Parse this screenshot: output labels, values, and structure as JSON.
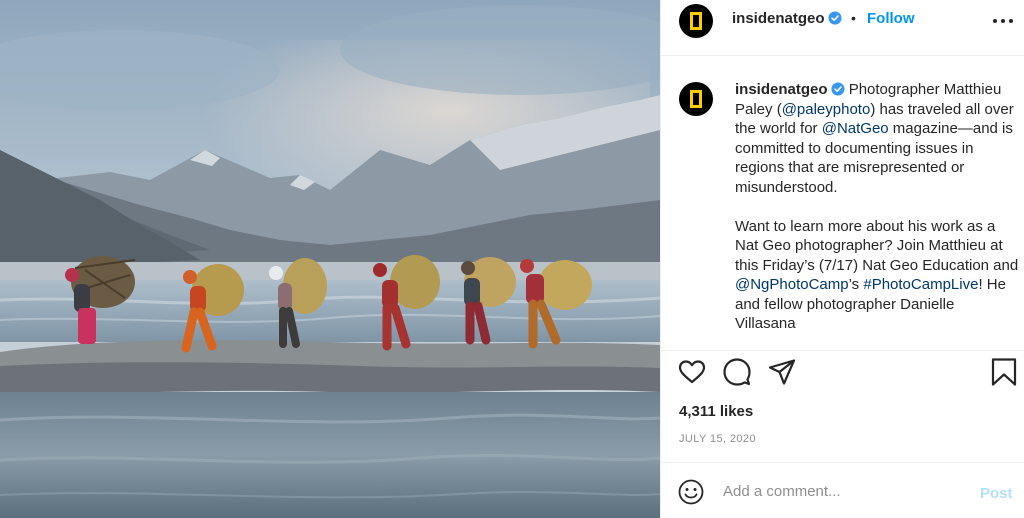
{
  "header": {
    "username": "insidenatgeo",
    "separator": "•",
    "follow_label": "Follow",
    "avatar_icon": "national-geographic-logo-icon",
    "more_icon": "more-horizontal-icon"
  },
  "caption": {
    "username": "insidenatgeo",
    "p1_a": "Photographer Matthieu Paley (",
    "mention_photographer": "@paleyphoto",
    "p1_b": ") has traveled all over the world for ",
    "mention_magazine": "@NatGeo",
    "p1_c": " magazine—and is committed to documenting issues in regions that are misrepresented or misunderstood.",
    "p2_a": "Want to learn more about his work as a Nat Geo photographer? Join Matthieu at this Friday’s (7/17) Nat Geo Education and ",
    "mention_photocamp": "@NgPhotoCamp",
    "p2_b": "’s ",
    "hashtag": "#PhotoCampLive",
    "p2_c": "! He and fellow photographer Danielle Villasana"
  },
  "actions": {
    "like_icon": "heart-icon",
    "comment_icon": "comment-icon",
    "share_icon": "send-icon",
    "save_icon": "bookmark-icon"
  },
  "likes": "4,311 likes",
  "date": "JULY 15, 2020",
  "comment_box": {
    "placeholder": "Add a comment...",
    "post_label": "Post",
    "emoji_icon": "smiley-icon"
  },
  "colors": {
    "accent": "#0095f6",
    "link": "#00376b",
    "muted": "#8e8e8e",
    "post_disabled": "#b2dffc",
    "logo_yellow": "#ffce00"
  }
}
